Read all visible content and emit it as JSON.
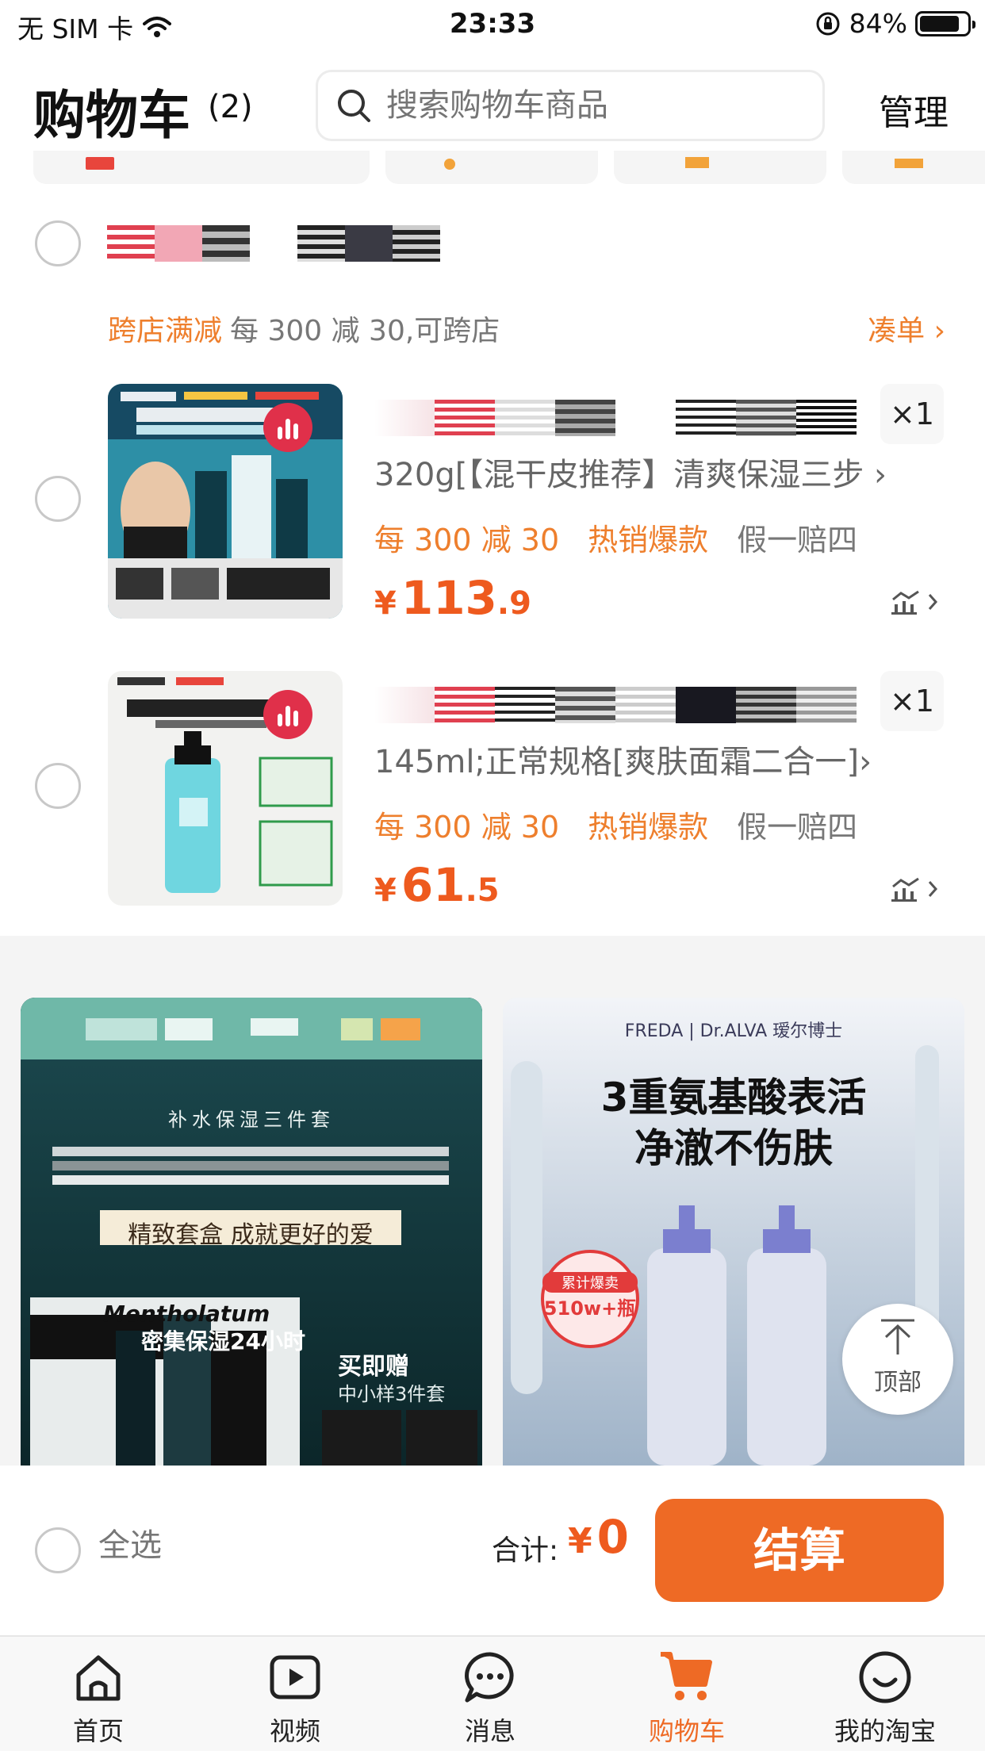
{
  "status_bar": {
    "carrier": "无 SIM 卡",
    "time": "23:33",
    "battery": "84%",
    "battery_level": 0.84
  },
  "header": {
    "title": "购物车",
    "count": "(2)",
    "search_placeholder": "搜索购物车商品",
    "manage": "管理"
  },
  "shop": {
    "promo_tag": "跨店满减",
    "promo_desc": "每 300 减 30,可跨店",
    "promo_link": "凑单",
    "items": [
      {
        "sku": "320g[【混干皮推荐】清爽保湿三步 ›",
        "tags": [
          "每 300 减 30",
          "热销爆款",
          "假一赔四"
        ],
        "qty": "×1",
        "price_currency": "¥",
        "price_int": "113",
        "price_dec": ".9"
      },
      {
        "sku": "145ml;正常规格[爽肤面霜二合一]›",
        "tags": [
          "每 300 减 30",
          "热销爆款",
          "假一赔四"
        ],
        "qty": "×1",
        "price_currency": "¥",
        "price_int": "61",
        "price_dec": ".5"
      }
    ]
  },
  "recommend": {
    "left": {
      "subtitle": "补水保湿三件套",
      "banner": "精致套盒 成就更好的爱",
      "brand": "Mentholatum",
      "box_text": "密集保湿24小时",
      "gift": "买即赠",
      "gift_sub": "中小样3件套"
    },
    "right": {
      "brands": "FREDA | Dr.ALVA 瑷尔博士",
      "headline_1": "3重氨基酸表活",
      "headline_2": "净澈不伤肤",
      "badge_1": "累计爆卖",
      "badge_2": "510w+瓶"
    }
  },
  "back_to_top": "顶部",
  "checkout": {
    "select_all": "全选",
    "total_label": "合计:",
    "total_currency": "¥",
    "total": "0",
    "button": "结算"
  },
  "tabs": [
    {
      "label": "首页",
      "icon": "home-icon"
    },
    {
      "label": "视频",
      "icon": "video-icon"
    },
    {
      "label": "消息",
      "icon": "message-icon"
    },
    {
      "label": "购物车",
      "icon": "cart-icon",
      "active": true
    },
    {
      "label": "我的淘宝",
      "icon": "profile-icon"
    }
  ],
  "colors": {
    "accent": "#ee6a25",
    "price": "#ee5a1e",
    "promo": "#ee7f2d"
  }
}
